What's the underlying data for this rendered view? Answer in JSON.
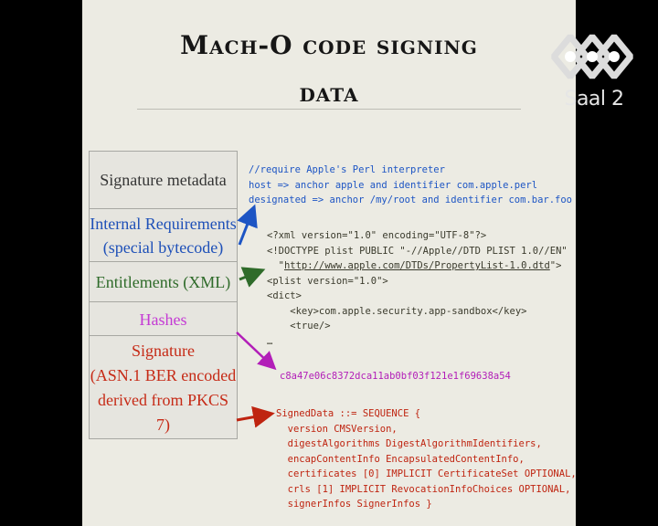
{
  "slide": {
    "title_line1": "Mach-O code signing",
    "title_line2": "data"
  },
  "table": {
    "rows": [
      {
        "label": "Signature metadata",
        "color": "#353535"
      },
      {
        "label": "Internal Requirements (special bytecode)",
        "color": "#1e50b8"
      },
      {
        "label": "Entitlements (XML)",
        "color": "#2f6b2a"
      },
      {
        "label": "Hashes",
        "color": "#c43ad4"
      },
      {
        "label": "Signature (ASN.1 BER encoded derived from PKCS 7)",
        "color": "#c62a16"
      }
    ],
    "row2_line1": "Internal Requirements",
    "row2_line2": "(special bytecode)",
    "row5_line1": "Signature",
    "row5_line2": "(ASN.1 BER encoded",
    "row5_line3": "derived from PKCS 7)"
  },
  "requirements_code": [
    "//require Apple's Perl interpreter",
    "host => anchor apple and identifier com.apple.perl",
    "designated => anchor /my/root and identifier com.bar.foo"
  ],
  "entitlements_code": {
    "line1": "<?xml version=\"1.0\" encoding=\"UTF-8\"?>",
    "line2": "<!DOCTYPE plist PUBLIC \"-//Apple//DTD PLIST 1.0//EN\"",
    "line3_prefix": "  \"",
    "line3_link": "http://www.apple.com/DTDs/PropertyList-1.0.dtd",
    "line3_suffix": "\">",
    "line4": "<plist version=\"1.0\">",
    "line5": "<dict>",
    "line6": "    <key>com.apple.security.app-sandbox</key>",
    "line7": "    <true/>",
    "line8": "…"
  },
  "hash_value": "c8a47e06c8372dca11ab0bf03f121e1f69638a54",
  "signature_code": [
    "SignedData ::= SEQUENCE {",
    "  version CMSVersion,",
    "  digestAlgorithms DigestAlgorithmIdentifiers,",
    "  encapContentInfo EncapsulatedContentInfo,",
    "  certificates [0] IMPLICIT CertificateSet OPTIONAL,",
    "  crls [1] IMPLICIT RevocationInfoChoices OPTIONAL,",
    "  signerInfos SignerInfos }"
  ],
  "overlay": {
    "room_label": "Saal 2",
    "logo_icon": "ccc-logo-icon"
  },
  "colors": {
    "blue": "#1d55c4",
    "green": "#2f6b2a",
    "magenta": "#b21eb8",
    "red": "#bf2410"
  }
}
